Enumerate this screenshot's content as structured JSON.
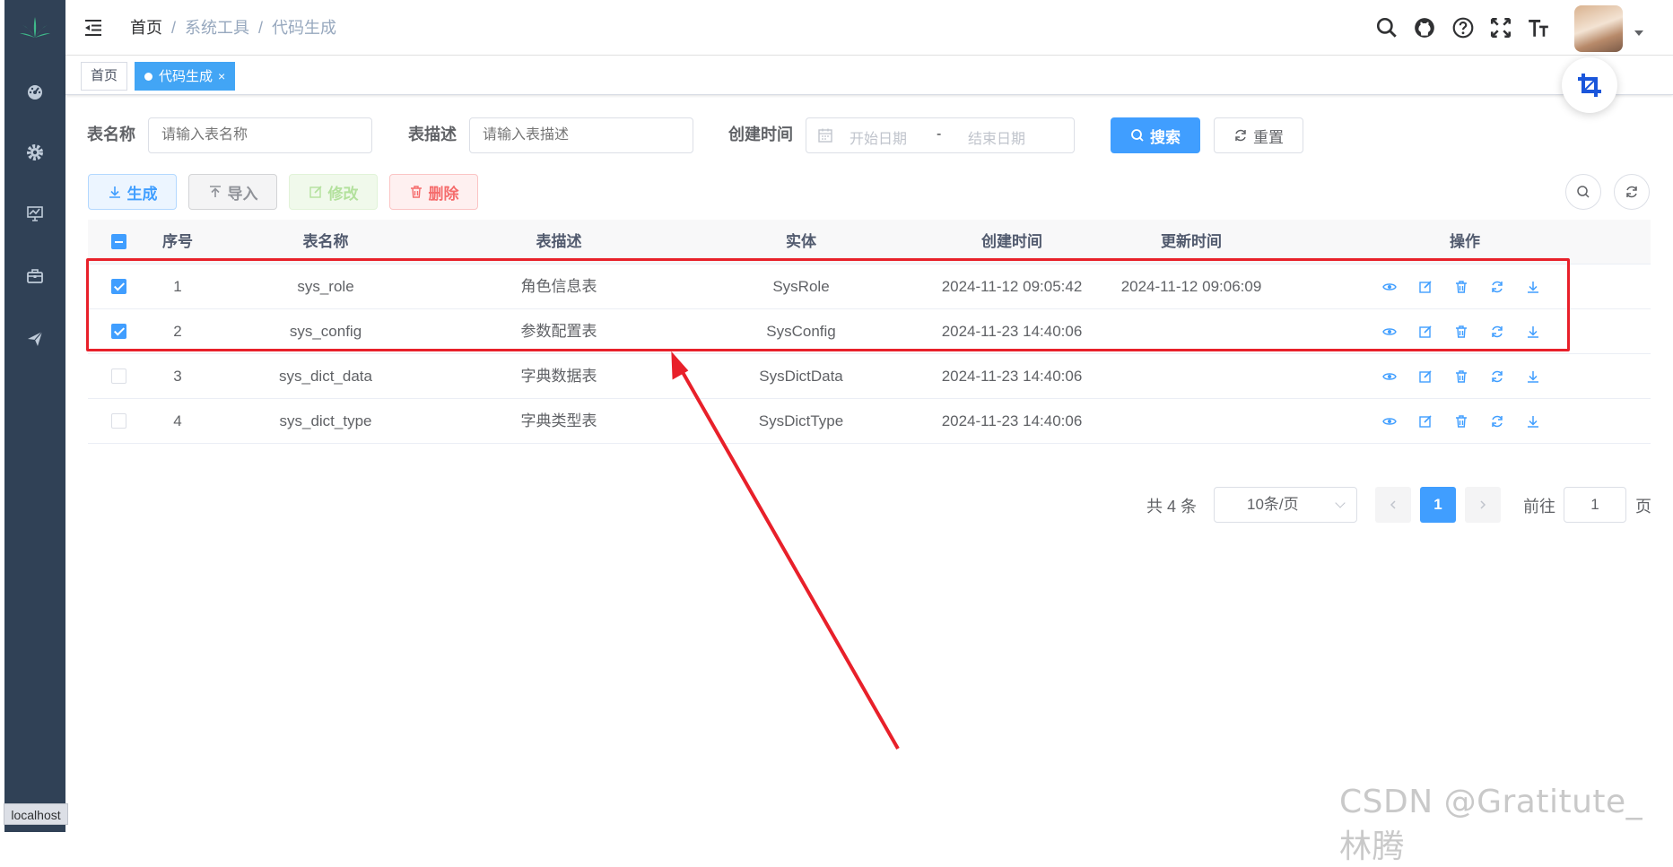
{
  "host_label": "localhost",
  "breadcrumb": {
    "home": "首页",
    "level1": "系统工具",
    "level2": "代码生成",
    "sep": "/"
  },
  "tags": {
    "home": "首页",
    "active": "代码生成",
    "close": "×"
  },
  "search": {
    "table_name_label": "表名称",
    "table_name_placeholder": "请输入表名称",
    "table_desc_label": "表描述",
    "table_desc_placeholder": "请输入表描述",
    "create_time_label": "创建时间",
    "start_placeholder": "开始日期",
    "range_sep": "-",
    "end_placeholder": "结束日期",
    "search_btn": "搜索",
    "reset_btn": "重置"
  },
  "toolbar": {
    "generate": "生成",
    "import": "导入",
    "edit": "修改",
    "delete": "删除"
  },
  "table": {
    "headers": {
      "index": "序号",
      "name": "表名称",
      "desc": "表描述",
      "entity": "实体",
      "created": "创建时间",
      "updated": "更新时间",
      "ops": "操作"
    },
    "rows": [
      {
        "checked": true,
        "index": "1",
        "name": "sys_role",
        "desc": "角色信息表",
        "entity": "SysRole",
        "created": "2024-11-12 09:05:42",
        "updated": "2024-11-12 09:06:09"
      },
      {
        "checked": true,
        "index": "2",
        "name": "sys_config",
        "desc": "参数配置表",
        "entity": "SysConfig",
        "created": "2024-11-23 14:40:06",
        "updated": ""
      },
      {
        "checked": false,
        "index": "3",
        "name": "sys_dict_data",
        "desc": "字典数据表",
        "entity": "SysDictData",
        "created": "2024-11-23 14:40:06",
        "updated": ""
      },
      {
        "checked": false,
        "index": "4",
        "name": "sys_dict_type",
        "desc": "字典类型表",
        "entity": "SysDictType",
        "created": "2024-11-23 14:40:06",
        "updated": ""
      }
    ]
  },
  "pagination": {
    "total": "共 4 条",
    "page_size": "10条/页",
    "current": "1",
    "goto_label": "前往",
    "goto_value": "1",
    "page_unit": "页"
  },
  "watermark": "CSDN @Gratitute_林腾",
  "colors": {
    "sidebar": "#304156",
    "primary": "#409eff",
    "annotation": "#e8202a"
  }
}
